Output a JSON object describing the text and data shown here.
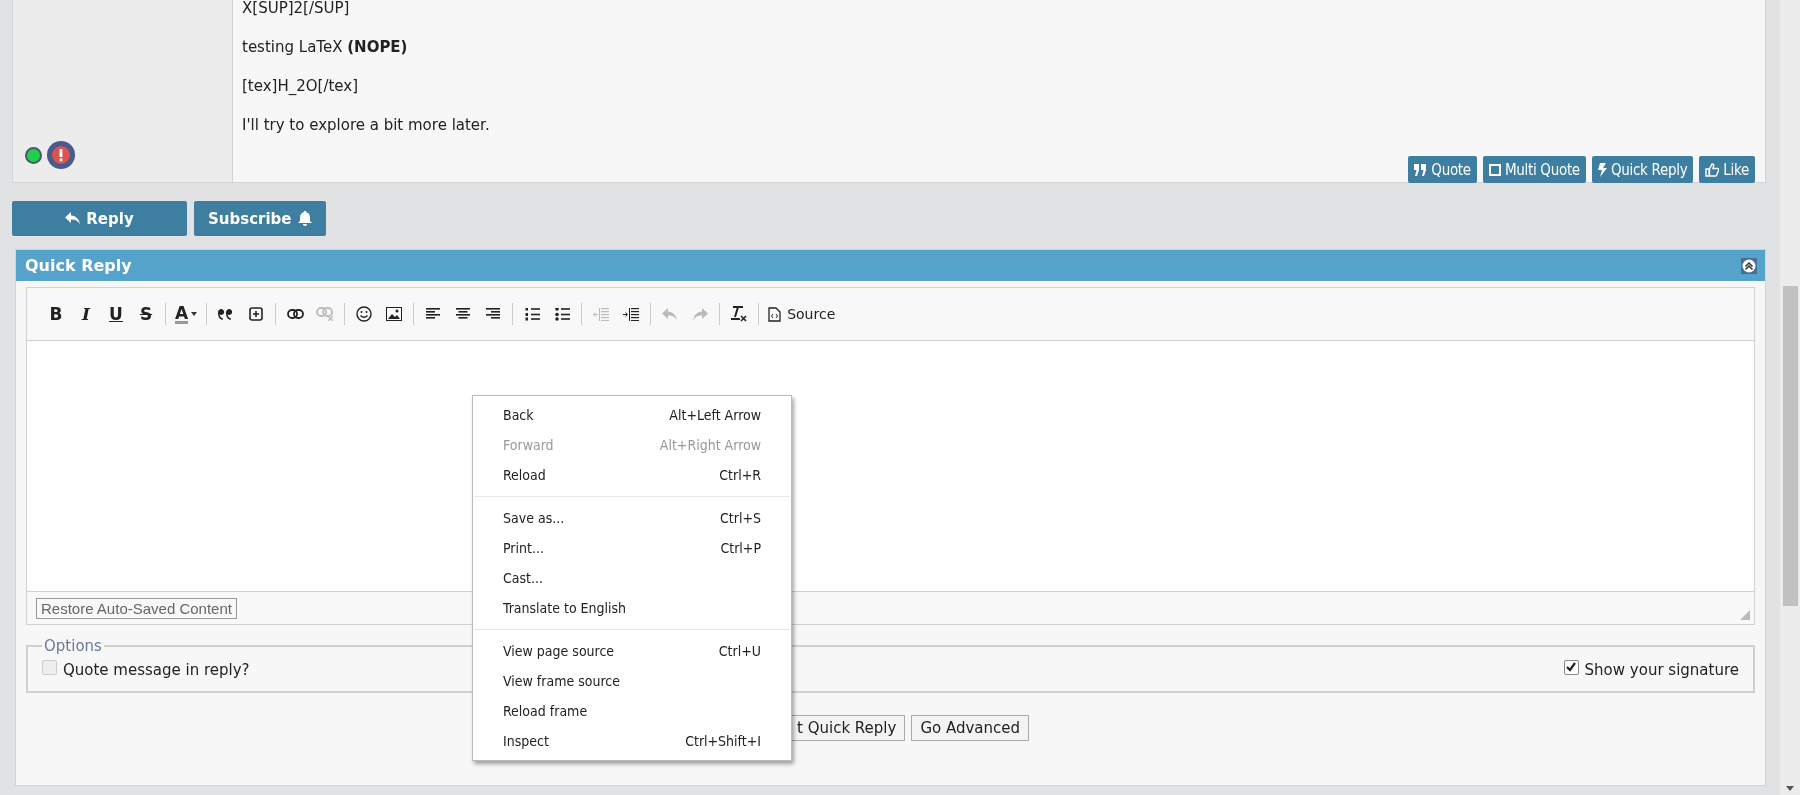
{
  "post": {
    "lines": [
      "X[SUP]2[/SUP]",
      "testing LaTeX **(NOPE)**",
      "[tex]H_2O[/tex]",
      "I'll try to explore a bit more later."
    ],
    "online": true,
    "actions": [
      {
        "kind": "quote",
        "label": "Quote"
      },
      {
        "kind": "multi",
        "label": "Multi Quote"
      },
      {
        "kind": "bolt",
        "label": "Quick Reply"
      },
      {
        "kind": "thumb",
        "label": "Like"
      }
    ]
  },
  "thread_buttons": [
    {
      "kind": "reply",
      "label": "Reply"
    },
    {
      "kind": "bell",
      "label": "Subscribe"
    }
  ],
  "quick_reply": {
    "title": "Quick Reply",
    "toolbar": [
      [
        {
          "kind": "bold",
          "label": "B",
          "disabled": false
        },
        {
          "kind": "italic",
          "label": "I",
          "disabled": false
        },
        {
          "kind": "underline",
          "label": "U",
          "disabled": false
        },
        {
          "kind": "strike",
          "label": "S",
          "disabled": false
        }
      ],
      [
        {
          "kind": "color",
          "label": "A",
          "disabled": false
        }
      ],
      [
        {
          "kind": "blockquote",
          "disabled": false
        },
        {
          "kind": "table",
          "disabled": false
        }
      ],
      [
        {
          "kind": "link",
          "disabled": false
        },
        {
          "kind": "unlink",
          "disabled": true
        }
      ],
      [
        {
          "kind": "smiley",
          "disabled": false
        },
        {
          "kind": "image",
          "disabled": false
        }
      ],
      [
        {
          "kind": "align-left",
          "disabled": false
        },
        {
          "kind": "align-center",
          "disabled": false
        },
        {
          "kind": "align-right",
          "disabled": false
        }
      ],
      [
        {
          "kind": "numbered-list",
          "disabled": false
        },
        {
          "kind": "bullet-list",
          "disabled": false
        }
      ],
      [
        {
          "kind": "outdent",
          "disabled": true
        },
        {
          "kind": "indent",
          "disabled": false
        }
      ],
      [
        {
          "kind": "undo",
          "disabled": true
        },
        {
          "kind": "redo",
          "disabled": true
        }
      ],
      [
        {
          "kind": "clear-format",
          "disabled": false
        }
      ],
      [
        {
          "kind": "source",
          "label": "Source",
          "disabled": false
        }
      ]
    ],
    "restore": "Restore Auto-Saved Content",
    "options": {
      "legend": "Options",
      "checkboxes": [
        {
          "label": "Quote message in reply?",
          "checked": false,
          "disabled": true
        },
        {
          "label": "Show your signature",
          "checked": true,
          "disabled": false
        }
      ]
    },
    "buttons": [
      "t Quick Reply",
      "Go Advanced"
    ]
  },
  "context_menu": [
    [
      {
        "label": "Back",
        "shortcut": "Alt+Left Arrow",
        "disabled": false
      },
      {
        "label": "Forward",
        "shortcut": "Alt+Right Arrow",
        "disabled": true
      },
      {
        "label": "Reload",
        "shortcut": "Ctrl+R",
        "disabled": false
      }
    ],
    [
      {
        "label": "Save as...",
        "shortcut": "Ctrl+S",
        "disabled": false
      },
      {
        "label": "Print...",
        "shortcut": "Ctrl+P",
        "disabled": false
      },
      {
        "label": "Cast...",
        "disabled": false
      },
      {
        "label": "Translate to English",
        "disabled": false
      }
    ],
    [
      {
        "label": "View page source",
        "shortcut": "Ctrl+U",
        "disabled": false
      },
      {
        "label": "View frame source",
        "disabled": false
      },
      {
        "label": "Reload frame",
        "disabled": false
      },
      {
        "label": "Inspect",
        "shortcut": "Ctrl+Shift+I",
        "disabled": false
      }
    ]
  ]
}
